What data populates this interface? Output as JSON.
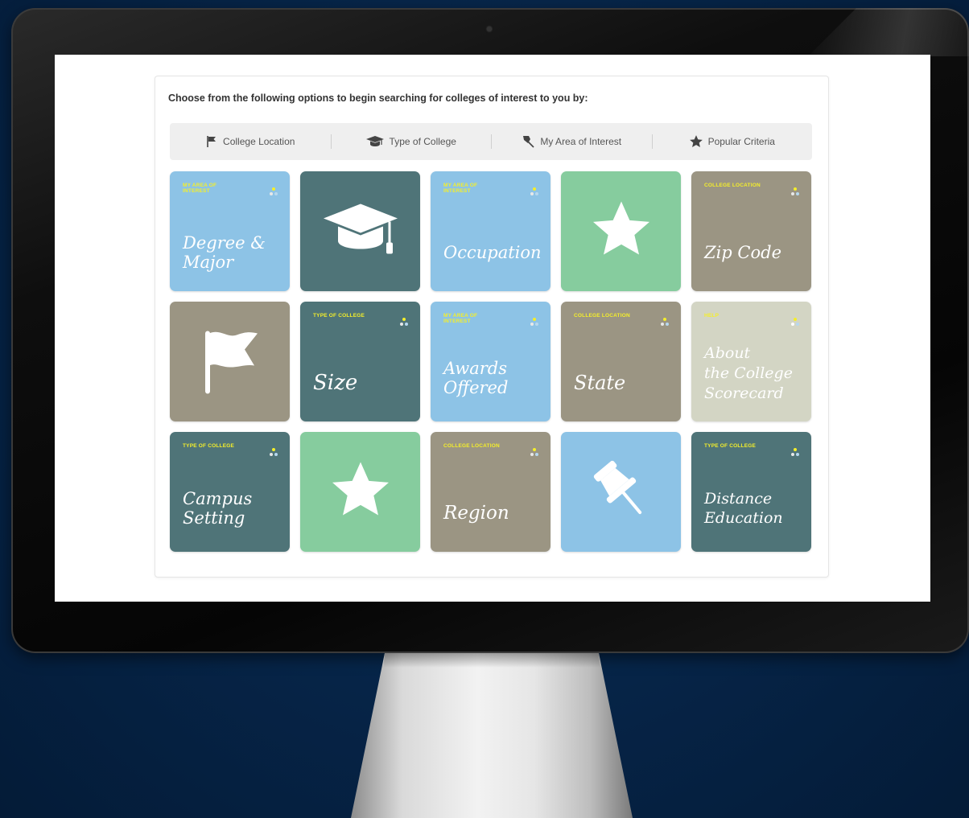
{
  "colors": {
    "blue": "#8dc3e6",
    "teal": "#4f7478",
    "green": "#86cc9e",
    "taupe": "#9b9583",
    "sage": "#d3d5c4",
    "tag_yellow": "#f5ef2a"
  },
  "intro_text": "Choose from the following options to begin searching for colleges of interest to you by:",
  "tabs": [
    {
      "label": "College Location",
      "icon": "flag-icon"
    },
    {
      "label": "Type of College",
      "icon": "graduation-cap-icon"
    },
    {
      "label": "My Area of Interest",
      "icon": "pushpin-icon"
    },
    {
      "label": "Popular Criteria",
      "icon": "star-icon"
    }
  ],
  "tiles": [
    {
      "tag": "My Area of Interest",
      "label": "Degree &\nMajor",
      "color": "blue"
    },
    {
      "icon": "graduation-cap-icon",
      "color": "teal"
    },
    {
      "tag": "My Area of Interest",
      "label": "Occupation",
      "color": "blue"
    },
    {
      "icon": "star-icon",
      "color": "green"
    },
    {
      "tag": "College Location",
      "label": "Zip Code",
      "color": "taupe"
    },
    {
      "icon": "flag-icon",
      "color": "taupe"
    },
    {
      "tag": "Type of College",
      "label": "Size",
      "color": "teal"
    },
    {
      "tag": "My Area of Interest",
      "label": "Awards\nOffered",
      "color": "blue"
    },
    {
      "tag": "College Location",
      "label": "State",
      "color": "taupe"
    },
    {
      "tag": "Help",
      "label": "About\nthe College\nScorecard",
      "color": "sage"
    },
    {
      "tag": "Type of College",
      "label": "Campus\nSetting",
      "color": "teal"
    },
    {
      "icon": "star-icon",
      "color": "green"
    },
    {
      "tag": "College Location",
      "label": "Region",
      "color": "taupe"
    },
    {
      "icon": "pushpin-icon",
      "color": "blue"
    },
    {
      "tag": "Type of College",
      "label": "Distance\nEducation",
      "color": "teal"
    }
  ]
}
